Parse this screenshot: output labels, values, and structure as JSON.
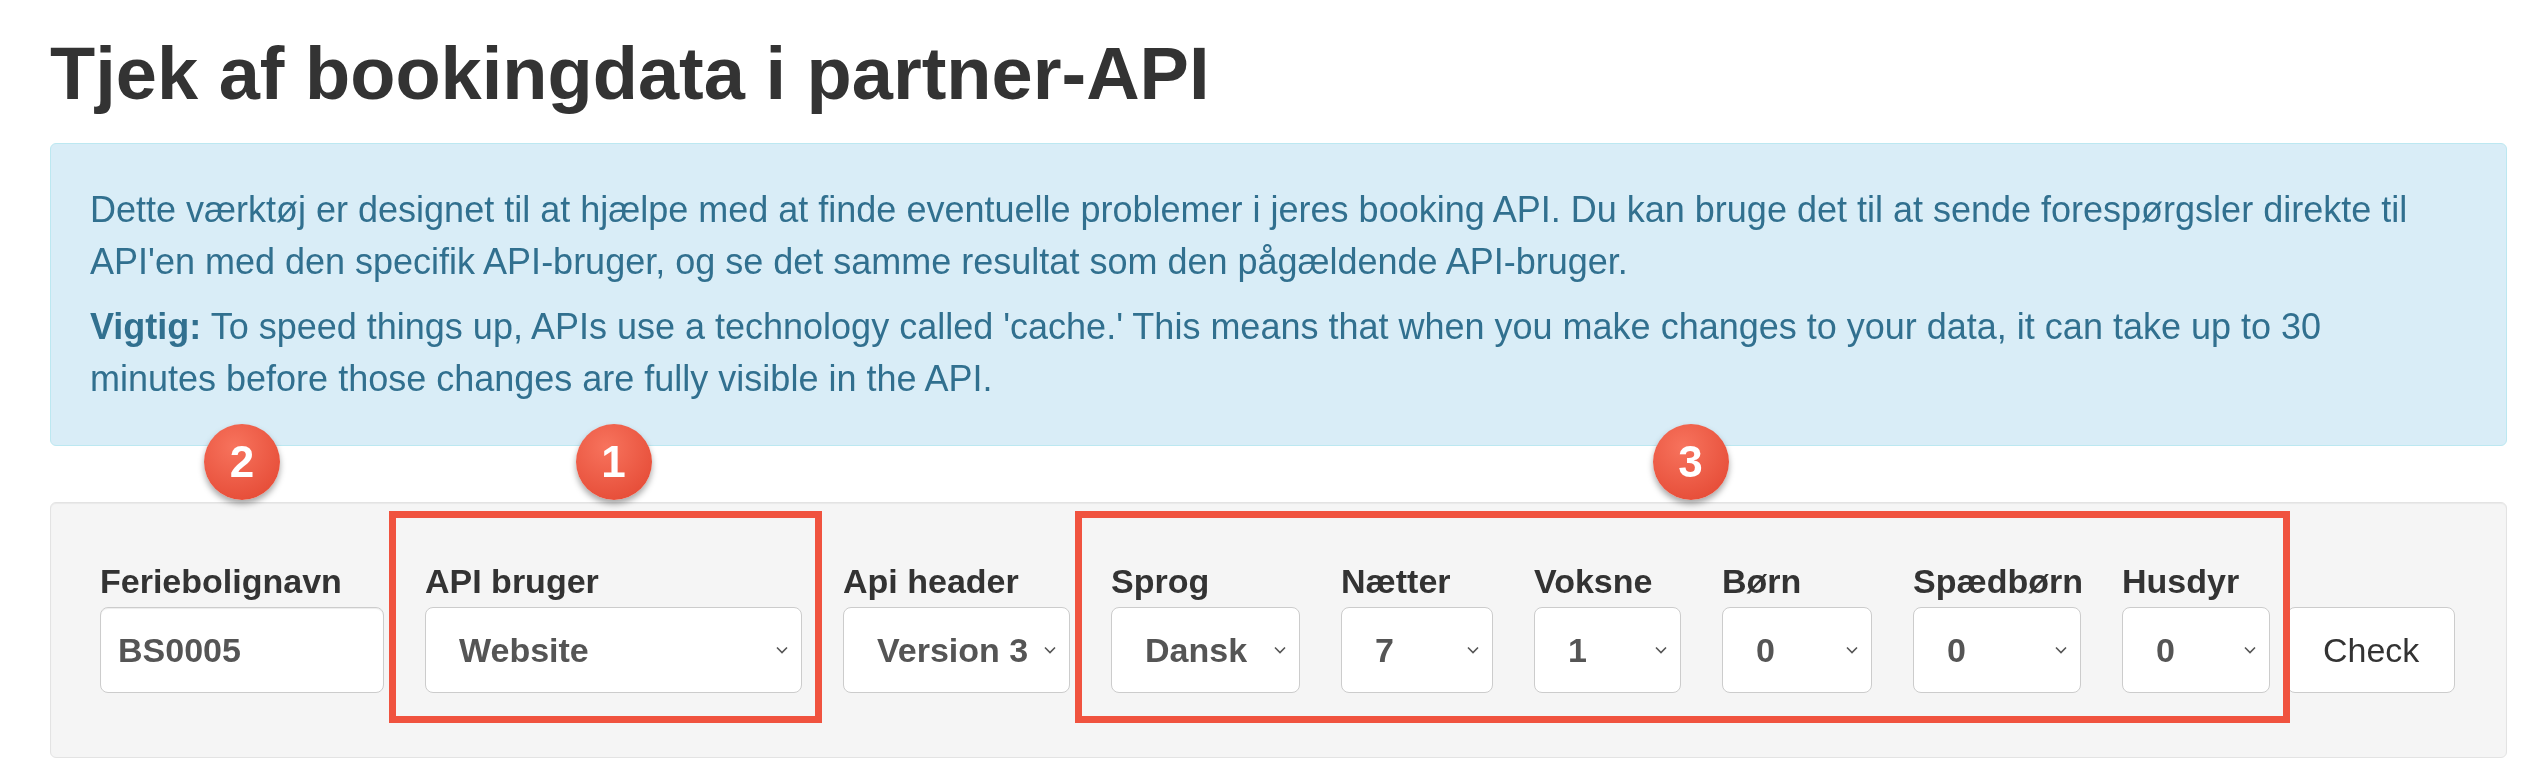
{
  "title": "Tjek af bookingdata i partner-API",
  "info_box": {
    "paragraphs": [
      "Dette værktøj er designet til at hjælpe med at finde eventuelle problemer i jeres booking API. Du kan bruge det til at sende forespørgsler direkte til API'en med den specifik API-bruger, og se det samme resultat som den pågældende API-bruger.",
      "**Vigtig:** To speed things up, APIs use a technology called 'cache.' This means that when you make changes to your data, it can take up to 30 minutes before those changes are fully visible in the API."
    ]
  },
  "form": {
    "groups": [
      {
        "badge": "2",
        "highlighted": false,
        "fields": [
          {
            "kind": "text",
            "label": "Feriebolignavn",
            "value": "BS0005"
          }
        ]
      },
      {
        "badge": "1",
        "highlighted": true,
        "fields": [
          {
            "kind": "select",
            "label": "API bruger",
            "value": "Website"
          }
        ]
      },
      {
        "highlighted": false,
        "fields": [
          {
            "kind": "select",
            "label": "Api header",
            "value": "Version 3"
          }
        ]
      },
      {
        "badge": "3",
        "highlighted": true,
        "fields": [
          {
            "kind": "select",
            "label": "Sprog",
            "value": "Dansk"
          },
          {
            "kind": "select",
            "label": "Nætter",
            "value": "7"
          },
          {
            "kind": "select",
            "label": "Voksne",
            "value": "1"
          },
          {
            "kind": "select",
            "label": "Børn",
            "value": "0"
          },
          {
            "kind": "select",
            "label": "Spædbørn",
            "value": "0"
          },
          {
            "kind": "select",
            "label": "Husdyr",
            "value": "0"
          }
        ]
      }
    ],
    "button": "Check"
  }
}
